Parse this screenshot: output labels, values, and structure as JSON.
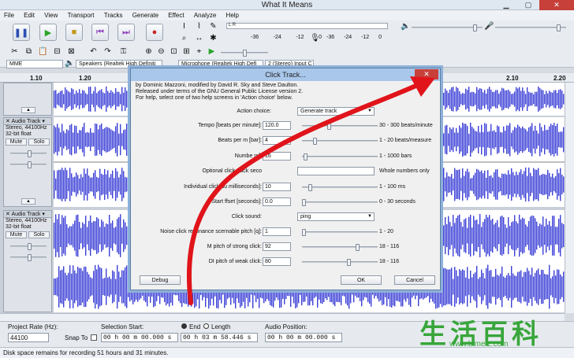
{
  "window": {
    "title": "What It Means"
  },
  "menu": [
    "File",
    "Edit",
    "View",
    "Transport",
    "Tracks",
    "Generate",
    "Effect",
    "Analyze",
    "Help"
  ],
  "meters": {
    "record_ticks": [
      "-36",
      "-24",
      "-12",
      "0"
    ],
    "play_ticks": [
      "-36",
      "-24",
      "-12",
      "0"
    ],
    "record_label": "L R",
    "play_label": "L R"
  },
  "device": {
    "host": "MME",
    "output": "Speakers (Realtek High Definiti",
    "input": "Microphone (Realtek High Defi",
    "channels": "2 (Stereo) Input C"
  },
  "ruler": [
    "1.10",
    "1.20",
    "2.10",
    "2.20"
  ],
  "tracks": [
    {
      "name": "Audio Track",
      "info1": "Stereo, 44100Hz",
      "info2": "32-bit float",
      "mute": "Mute",
      "solo": "Solo"
    },
    {
      "name": "Audio Track",
      "info1": "Stereo, 44100Hz",
      "info2": "32-bit float",
      "mute": "Mute",
      "solo": "Solo"
    }
  ],
  "dialog": {
    "title": "Click Track...",
    "close": "✕",
    "intro": [
      "by Dominic Mazzoni, modified by David R. Sky and Steve Daulton.",
      "Released under terms of the GNU General Public License version 2.",
      "For help, select one of two help screens in 'Action choice' below."
    ],
    "action_label": "Action choice:",
    "action_value": "Generate track",
    "tempo_label": "Tempo [beats per minute]:",
    "tempo_value": "120.0",
    "tempo_range": "30 - 300 beats/minute",
    "tempo_level": 0.35,
    "beats_label": "Beats per m      [bar]:",
    "beats_value": "4",
    "beats_range": "1 - 20 beats/measure",
    "beats_level": 0.15,
    "number_label": "Numbe               rs]:",
    "number_value": "16",
    "number_range": "1 - 1000 bars",
    "number_level": 0.02,
    "optional_label": "Optional click track        seco",
    "optional_value": "",
    "optional_range": "Whole numbers only",
    "individual_label": "Individual click du         milliseconds]:",
    "individual_value": "10",
    "individual_range": "1 - 100 ms",
    "individual_level": 0.09,
    "start_label": "Start       ffset [seconds]:",
    "start_value": "0.0",
    "start_range": "0 - 30 seconds",
    "start_level": 0.0,
    "sound_label": "Click sound:",
    "sound_value": "ping",
    "resonance_label": "Noise click resonance      scernable pitch [q]:",
    "resonance_value": "1",
    "resonance_range": "1 - 20",
    "resonance_level": 0.0,
    "strong_label": "M      pitch of strong click:",
    "strong_value": "92",
    "strong_range": "18 - 116",
    "strong_level": 0.76,
    "weak_label": "DI pitch of weak click:",
    "weak_value": "80",
    "weak_range": "18 - 116",
    "weak_level": 0.63,
    "debug": "Debug",
    "ok": "OK",
    "cancel": "Cancel"
  },
  "selection_bar": {
    "rate_label": "Project Rate (Hz):",
    "rate_value": "44100",
    "snap_label": "Snap To",
    "sel_start_label": "Selection Start:",
    "end_label": "End",
    "length_label": "Length",
    "audio_pos_label": "Audio Position:",
    "sel_start_value": "00 h 00 m 00.000 s",
    "end_value": "00 h 03 m 58.446 s",
    "audio_pos_value": "00 h 00 m 00.000 s"
  },
  "status": "Disk space remains for recording 51 hours and 31 minutes.",
  "watermark": {
    "chars": "生活百科",
    "url": "www.bimeiz.com"
  },
  "colors": {
    "wave": "#3b3fd6",
    "dialog_title": "#a9c7ea",
    "arrow": "#e0141a",
    "watermark": "#38a63a"
  }
}
